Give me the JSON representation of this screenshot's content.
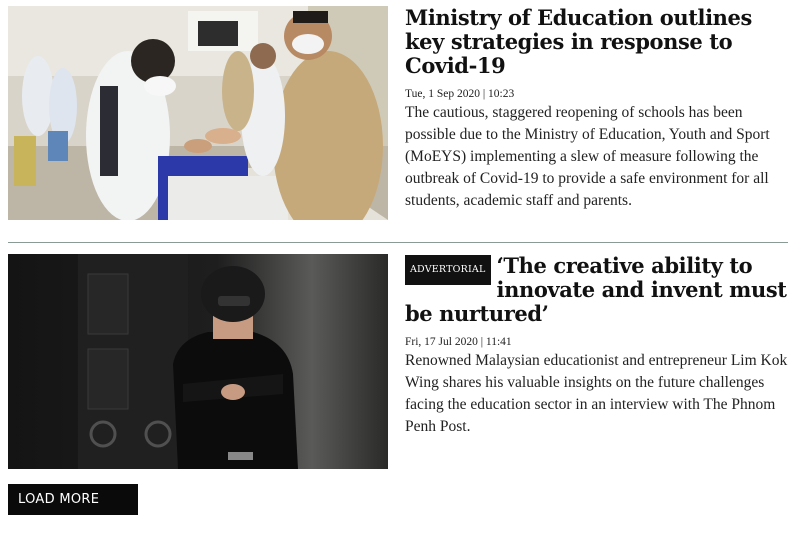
{
  "articles": [
    {
      "headline": "Ministry of Education outlines key strategies in response to Covid-19",
      "meta": "Tue, 1 Sep 2020 | 10:23",
      "summary": "The cautious, staggered reopening of schools has been possible due to the Ministry of Education, Youth and Sport (MoEYS) implementing a slew of measure following the outbreak of Covid-19 to provide a safe environment for all students, academic staff and parents."
    },
    {
      "badge": "ADVERTORIAL",
      "headline": "‘The creative ability to innovate and invent must be nurtured’",
      "meta": "Fri, 17 Jul 2020 | 11:41",
      "summary": "Renowned Malaysian educationist and entrepreneur Lim Kok Wing shares his valuable insights on the future challenges facing the education sector in an interview with The Phnom Penh Post."
    }
  ],
  "load_more_label": "LOAD MORE"
}
